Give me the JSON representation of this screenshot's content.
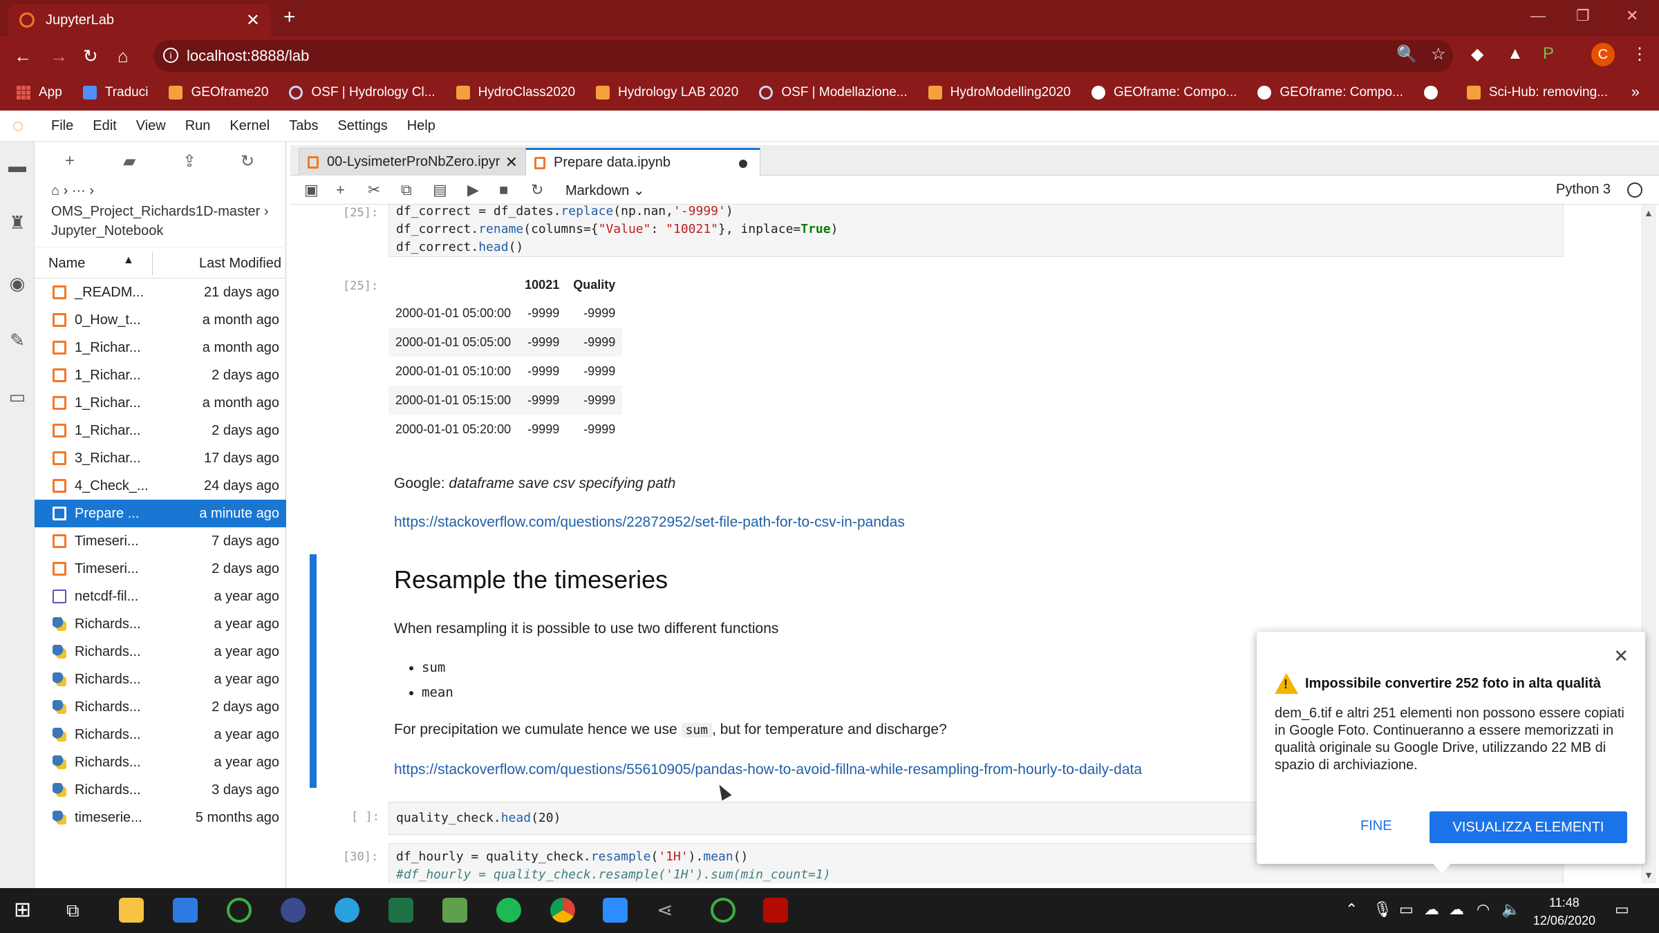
{
  "browser": {
    "tab_title": "JupyterLab",
    "url": "localhost:8888/lab",
    "avatar_letter": "C",
    "bookmarks": [
      "App",
      "Traduci",
      "GEOframe20",
      "OSF | Hydrology Cl...",
      "HydroClass2020",
      "Hydrology LAB 2020",
      "OSF | Modellazione...",
      "HydroModelling2020",
      "GEOframe: Compo...",
      "GEOframe: Compo...",
      "",
      "Sci-Hub: removing..."
    ]
  },
  "menu": [
    "File",
    "Edit",
    "View",
    "Run",
    "Kernel",
    "Tabs",
    "Settings",
    "Help"
  ],
  "filebrowser": {
    "crumb_path": "⌂ › ··· ›",
    "crumb_folder": "OMS_Project_Richards1D-master ›",
    "crumb_sub": "Jupyter_Notebook",
    "col_name": "Name",
    "col_modified": "Last Modified",
    "files": [
      {
        "name": "_READM...",
        "modified": "21 days ago",
        "kind": "nb"
      },
      {
        "name": "0_How_t...",
        "modified": "a month ago",
        "kind": "nb"
      },
      {
        "name": "1_Richar...",
        "modified": "a month ago",
        "kind": "nb"
      },
      {
        "name": "1_Richar...",
        "modified": "2 days ago",
        "kind": "nb"
      },
      {
        "name": "1_Richar...",
        "modified": "a month ago",
        "kind": "nb"
      },
      {
        "name": "1_Richar...",
        "modified": "2 days ago",
        "kind": "nb"
      },
      {
        "name": "3_Richar...",
        "modified": "17 days ago",
        "kind": "nb"
      },
      {
        "name": "4_Check_...",
        "modified": "24 days ago",
        "kind": "nb"
      },
      {
        "name": "Prepare ...",
        "modified": "a minute ago",
        "kind": "nb",
        "selected": true
      },
      {
        "name": "Timeseri...",
        "modified": "7 days ago",
        "kind": "nb"
      },
      {
        "name": "Timeseri...",
        "modified": "2 days ago",
        "kind": "nb"
      },
      {
        "name": "netcdf-fil...",
        "modified": "a year ago",
        "kind": "nc"
      },
      {
        "name": "Richards...",
        "modified": "a year ago",
        "kind": "py"
      },
      {
        "name": "Richards...",
        "modified": "a year ago",
        "kind": "py"
      },
      {
        "name": "Richards...",
        "modified": "a year ago",
        "kind": "py"
      },
      {
        "name": "Richards...",
        "modified": "2 days ago",
        "kind": "py"
      },
      {
        "name": "Richards...",
        "modified": "a year ago",
        "kind": "py"
      },
      {
        "name": "Richards...",
        "modified": "a year ago",
        "kind": "py"
      },
      {
        "name": "Richards...",
        "modified": "3 days ago",
        "kind": "py"
      },
      {
        "name": "timeserie...",
        "modified": "5 months ago",
        "kind": "py"
      }
    ]
  },
  "notebook": {
    "tabs": [
      {
        "label": "00-LysimeterProNbZero.ipyr"
      },
      {
        "label": "Prepare data.ipynb"
      }
    ],
    "cell_type": "Markdown ⌄",
    "kernel": "Python 3",
    "cell25_prompt": "[25]:",
    "out25_prompt": "[25]:",
    "table": {
      "columns": [
        "10021",
        "Quality"
      ],
      "rows": [
        [
          "2000-01-01 05:00:00",
          "-9999",
          "-9999"
        ],
        [
          "2000-01-01 05:05:00",
          "-9999",
          "-9999"
        ],
        [
          "2000-01-01 05:10:00",
          "-9999",
          "-9999"
        ],
        [
          "2000-01-01 05:15:00",
          "-9999",
          "-9999"
        ],
        [
          "2000-01-01 05:20:00",
          "-9999",
          "-9999"
        ]
      ]
    },
    "google_label": "Google:",
    "google_query": "dataframe save csv specifying path",
    "link1": "https://stackoverflow.com/questions/22872952/set-file-path-for-to-csv-in-pandas",
    "heading": "Resample the timeseries",
    "para1": "When resampling it is possible to use two different functions",
    "bullets": [
      "sum",
      "mean"
    ],
    "para2_a": "For precipitation we cumulate hence we use",
    "para2_code": "sum",
    "para2_b": ", but for temperature and discharge?",
    "link2": "https://stackoverflow.com/questions/55610905/pandas-how-to-avoid-fillna-while-resampling-from-hourly-to-daily-data",
    "empty_prompt": "[ ]:",
    "cell30_prompt": "[30]:"
  },
  "popup": {
    "title": "Impossibile convertire 252 foto in alta qualità",
    "body": "dem_6.tif e altri 251 elementi non possono essere copiati in Google Foto. Continueranno a essere memorizzati in qualità originale su Google Drive, utilizzando 22 MB di spazio di archiviazione.",
    "fine": "FINE",
    "view": "VISUALIZZA ELEMENTI"
  },
  "taskbar": {
    "time": "11:48",
    "date": "12/06/2020"
  }
}
